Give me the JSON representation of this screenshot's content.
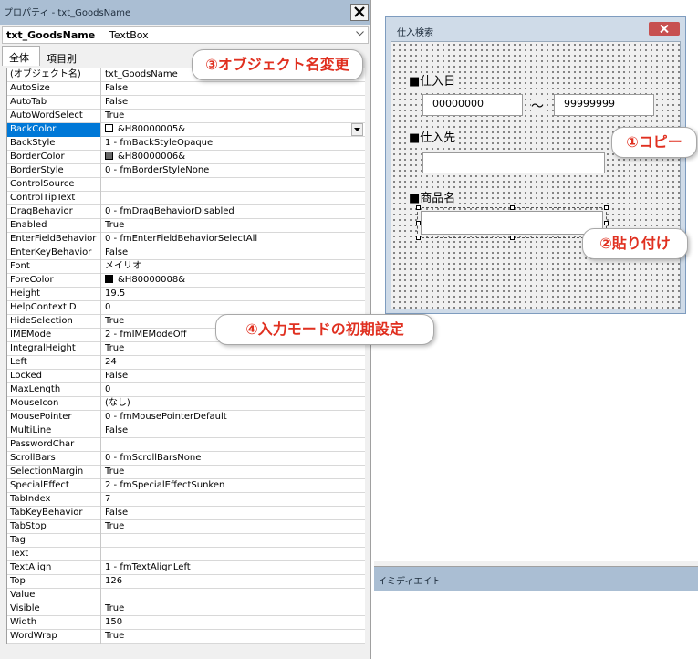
{
  "properties_window": {
    "title": "プロパティ - txt_GoodsName",
    "object_name": "txt_GoodsName",
    "object_type": "TextBox",
    "tabs": [
      "全体",
      "項目別"
    ],
    "rows": [
      {
        "name": "(オブジェクト名)",
        "value": "txt_GoodsName"
      },
      {
        "name": "AutoSize",
        "value": "False"
      },
      {
        "name": "AutoTab",
        "value": "False"
      },
      {
        "name": "AutoWordSelect",
        "value": "True"
      },
      {
        "name": "BackColor",
        "value": "&H80000005&",
        "swatch": "#ffffff"
      },
      {
        "name": "BackStyle",
        "value": "1 - fmBackStyleOpaque"
      },
      {
        "name": "BorderColor",
        "value": "&H80000006&",
        "swatch": "#696969"
      },
      {
        "name": "BorderStyle",
        "value": "0 - fmBorderStyleNone"
      },
      {
        "name": "ControlSource",
        "value": ""
      },
      {
        "name": "ControlTipText",
        "value": ""
      },
      {
        "name": "DragBehavior",
        "value": "0 - fmDragBehaviorDisabled"
      },
      {
        "name": "Enabled",
        "value": "True"
      },
      {
        "name": "EnterFieldBehavior",
        "value": "0 - fmEnterFieldBehaviorSelectAll"
      },
      {
        "name": "EnterKeyBehavior",
        "value": "False"
      },
      {
        "name": "Font",
        "value": "メイリオ"
      },
      {
        "name": "ForeColor",
        "value": "&H80000008&",
        "swatch": "#000000"
      },
      {
        "name": "Height",
        "value": "19.5"
      },
      {
        "name": "HelpContextID",
        "value": "0"
      },
      {
        "name": "HideSelection",
        "value": "True"
      },
      {
        "name": "IMEMode",
        "value": "2 - fmIMEModeOff"
      },
      {
        "name": "IntegralHeight",
        "value": "True"
      },
      {
        "name": "Left",
        "value": "24"
      },
      {
        "name": "Locked",
        "value": "False"
      },
      {
        "name": "MaxLength",
        "value": "0"
      },
      {
        "name": "MouseIcon",
        "value": "(なし)"
      },
      {
        "name": "MousePointer",
        "value": "0 - fmMousePointerDefault"
      },
      {
        "name": "MultiLine",
        "value": "False"
      },
      {
        "name": "PasswordChar",
        "value": ""
      },
      {
        "name": "ScrollBars",
        "value": "0 - fmScrollBarsNone"
      },
      {
        "name": "SelectionMargin",
        "value": "True"
      },
      {
        "name": "SpecialEffect",
        "value": "2 - fmSpecialEffectSunken"
      },
      {
        "name": "TabIndex",
        "value": "7"
      },
      {
        "name": "TabKeyBehavior",
        "value": "False"
      },
      {
        "name": "TabStop",
        "value": "True"
      },
      {
        "name": "Tag",
        "value": ""
      },
      {
        "name": "Text",
        "value": ""
      },
      {
        "name": "TextAlign",
        "value": "1 - fmTextAlignLeft"
      },
      {
        "name": "Top",
        "value": "126"
      },
      {
        "name": "Value",
        "value": ""
      },
      {
        "name": "Visible",
        "value": "True"
      },
      {
        "name": "Width",
        "value": "150"
      },
      {
        "name": "WordWrap",
        "value": "True"
      }
    ],
    "selected_row": "BackColor"
  },
  "userform": {
    "title": "仕入検索",
    "label_date": "■仕入日",
    "date_from": "00000000",
    "tilde": "～",
    "date_to": "99999999",
    "label_supplier": "■仕入先",
    "label_goods": "■商品名"
  },
  "immediate": {
    "title": "イミディエイト"
  },
  "callouts": {
    "copy": "①コピー",
    "paste": "②貼り付け",
    "rename": "③オブジェクト名変更",
    "ime": "④入力モードの初期設定"
  },
  "colors": {
    "title_bar": "#aabed3",
    "selection": "#0078d7",
    "callout_text": "#e03020"
  }
}
